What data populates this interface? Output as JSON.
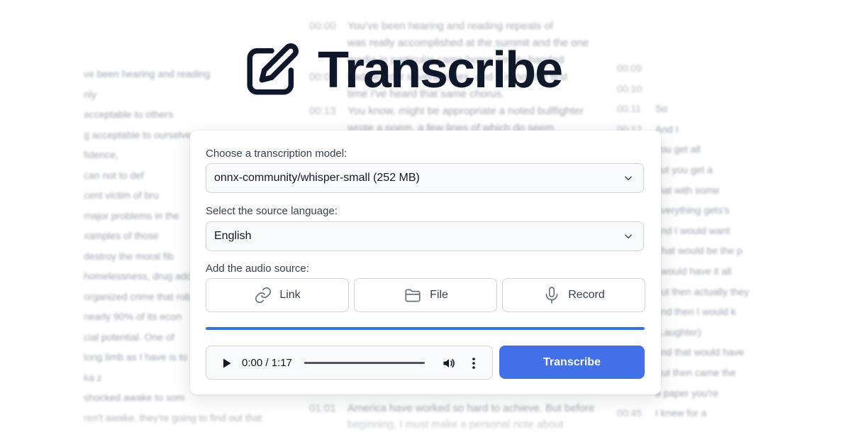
{
  "app": {
    "title": "Transcribe"
  },
  "form": {
    "model_label": "Choose a transcription model:",
    "model_value": "onnx-community/whisper-small (252 MB)",
    "language_label": "Select the source language:",
    "language_value": "English",
    "source_label": "Add the audio source:",
    "sources": [
      {
        "label": "Link",
        "icon": "link-icon"
      },
      {
        "label": "File",
        "icon": "folder-icon"
      },
      {
        "label": "Record",
        "icon": "microphone-icon"
      }
    ],
    "progress": 1.0,
    "player_time": "0:00 / 1:17",
    "transcribe_label": "Transcribe"
  },
  "colors": {
    "accent": "#4170e8",
    "title": "#0f172a"
  },
  "background_transcript": {
    "left": [
      "ve been hearing and reading",
      "nly",
      "acceptable to others",
      "g acceptable to ourselves",
      "fidence,",
      "can not to def",
      "cent victim of bru",
      "major problems in the",
      "xamples of those",
      "destroy the moral fib",
      "homelessness, drug addic",
      "organized crime that rob",
      "nearly 90% of its econ",
      "cial potential. One of",
      "long limb as I have is to",
      "ka z",
      "shocked awake to som",
      "ren't awake, they're going to find out that"
    ],
    "middle": [
      {
        "ts": "00:00",
        "text": "You've been hearing and reading repeats of"
      },
      {
        "ts": "",
        "text": "was really accomplished at the summit and the one"
      },
      {
        "ts": "",
        "text": "media in particular came home empty-handed"
      },
      {
        "ts": "00:07",
        "text": "had heard it several times, and it is not the first"
      },
      {
        "ts": "",
        "text": "time I've heard that same chorus."
      },
      {
        "ts": "00:13",
        "text": "You know, might be appropriate a noted bullfighter"
      },
      {
        "ts": "",
        "text": "wrote a poem, a few lines of which do seem"
      },
      {
        "ts": "01:01",
        "text": "America have worked so hard to achieve. But before"
      },
      {
        "ts": "",
        "text": "beginning, I must make a personal note about"
      }
    ],
    "right": [
      {
        "ts": "00:09",
        "text": ""
      },
      {
        "ts": "00:10",
        "text": ""
      },
      {
        "ts": "00:11",
        "text": "So"
      },
      {
        "ts": "00:12",
        "text": "And I"
      },
      {
        "ts": "",
        "text": "you get all"
      },
      {
        "ts": "",
        "text": "but you get a"
      },
      {
        "ts": "",
        "text": "that with some"
      },
      {
        "ts": "",
        "text": "everything gets's"
      },
      {
        "ts": "",
        "text": "and I would want"
      },
      {
        "ts": "",
        "text": "That would be the p"
      },
      {
        "ts": "",
        "text": "I would have it all"
      },
      {
        "ts": "",
        "text": "but then actually they"
      },
      {
        "ts": "",
        "text": "and then I would k"
      },
      {
        "ts": "",
        "text": "(Laughter)"
      },
      {
        "ts": "",
        "text": "and that would have"
      },
      {
        "ts": "",
        "text": "But then came the"
      },
      {
        "ts": "",
        "text": "a paper you're"
      },
      {
        "ts": "00:45",
        "text": "I knew for a"
      }
    ]
  }
}
